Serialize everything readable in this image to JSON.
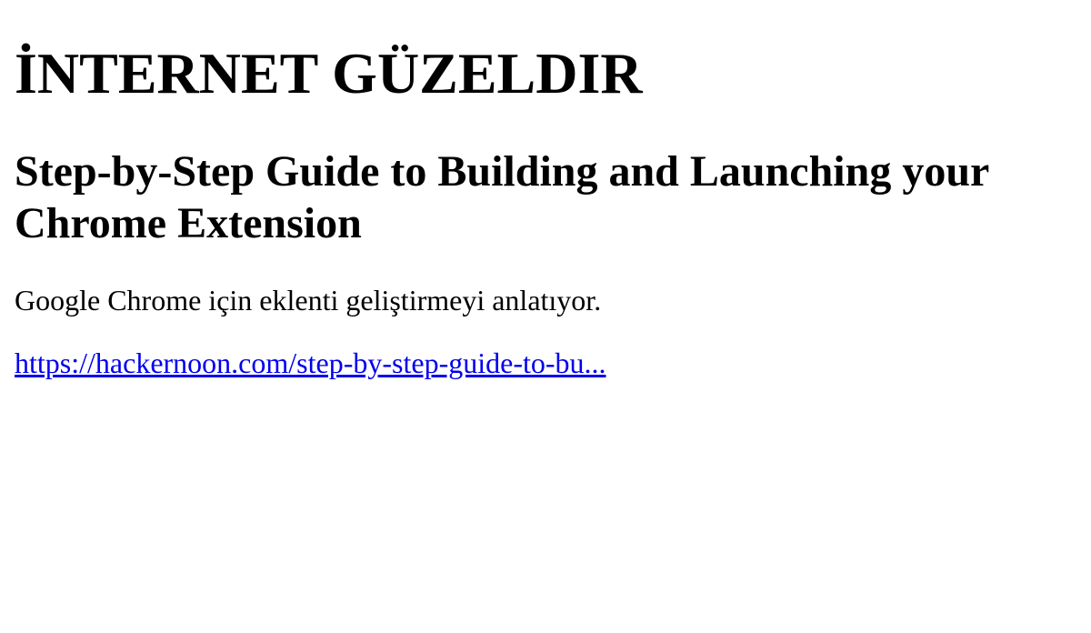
{
  "site": {
    "title": "İNTERNET GÜZELDIR"
  },
  "article": {
    "title": "Step-by-Step Guide to Building and Launching your Chrome Extension",
    "description": "Google Chrome için eklenti geliştirmeyi anlatıyor.",
    "link_text": "https://hackernoon.com/step-by-step-guide-to-bu..."
  },
  "colors": {
    "link": "#0000ee",
    "text": "#000000",
    "background": "#ffffff"
  }
}
